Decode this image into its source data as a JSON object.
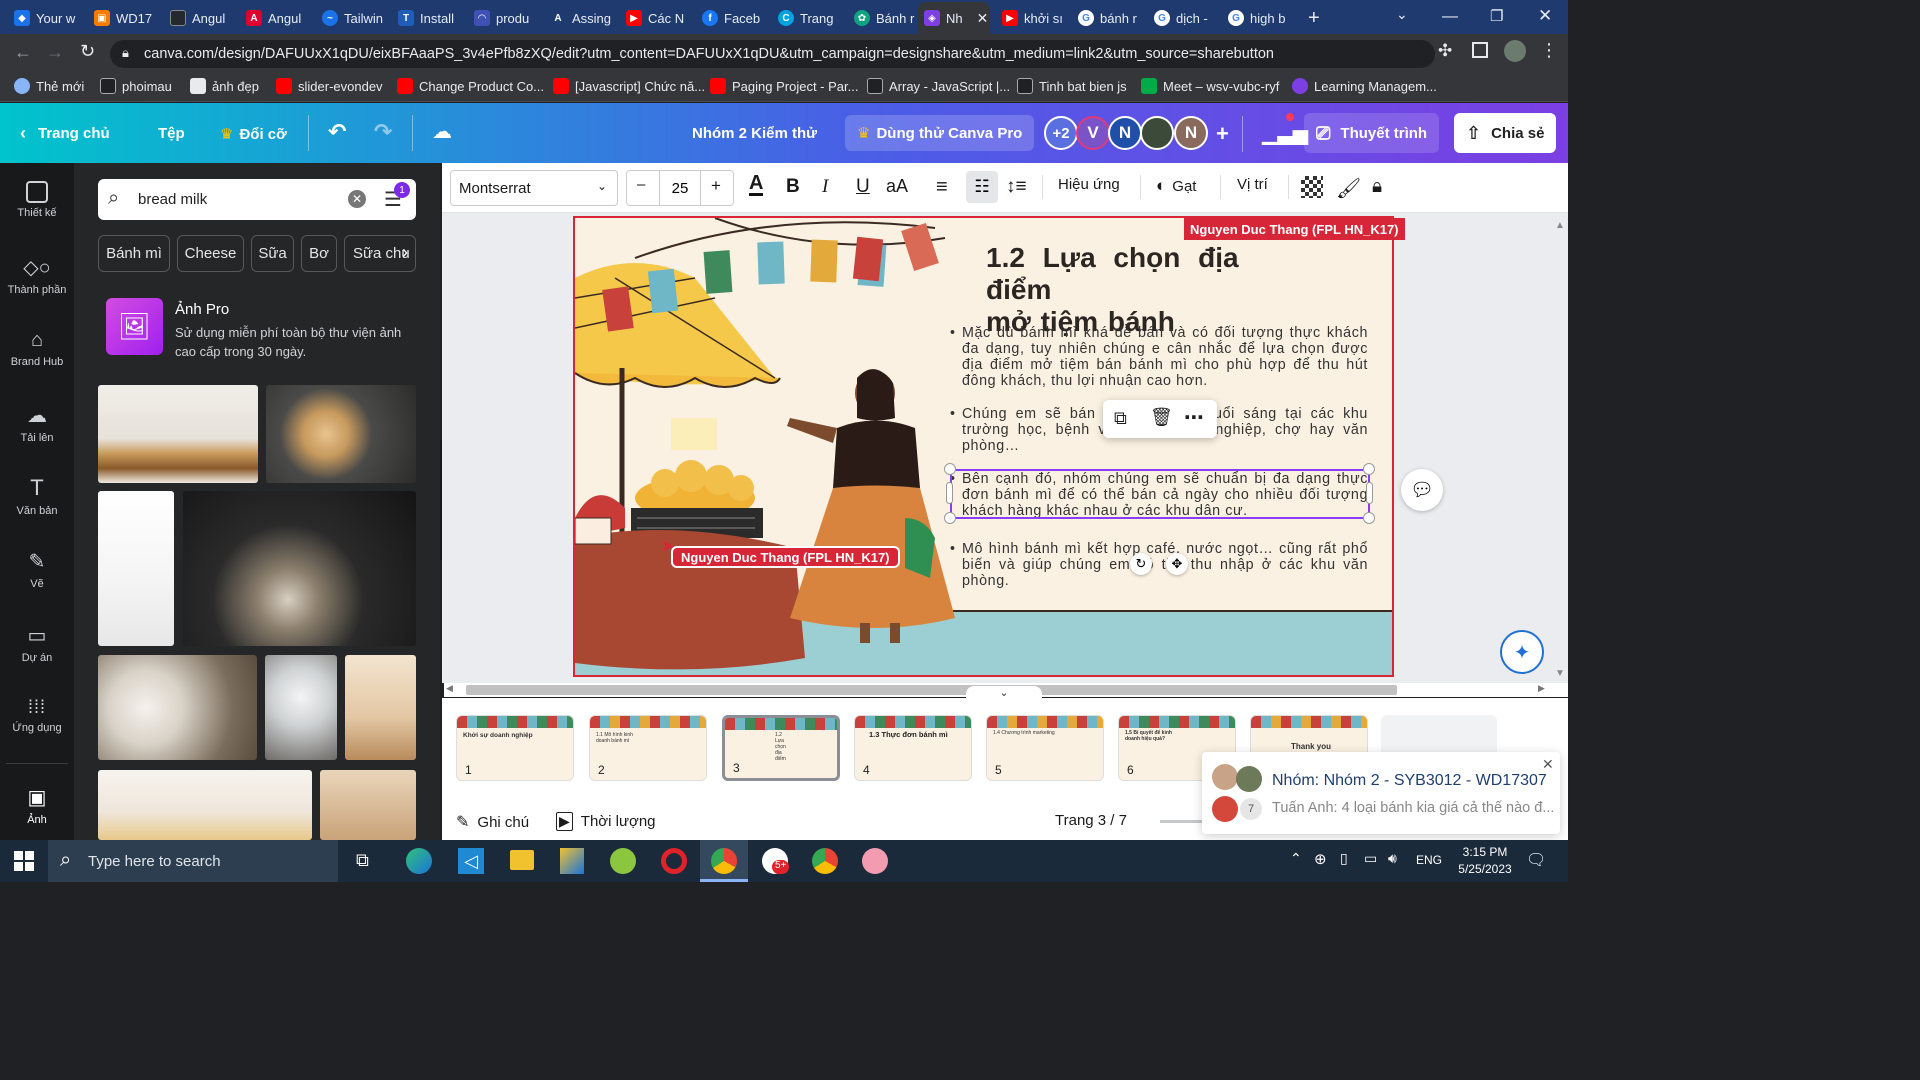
{
  "browser": {
    "tabs": [
      {
        "title": "Your w",
        "color": "#1a73e8"
      },
      {
        "title": "WD17",
        "color": "#f57c00"
      },
      {
        "title": "Angul",
        "color": "#24292f"
      },
      {
        "title": "Angul",
        "color": "#dd0031"
      },
      {
        "title": "Tailwin",
        "color": "#1a73e8"
      },
      {
        "title": "Install",
        "color": "#1e5eb8"
      },
      {
        "title": "produ",
        "color": "#3f51b5"
      },
      {
        "title": "Assing",
        "color": "#202124"
      },
      {
        "title": "Các N",
        "color": "#ff0000"
      },
      {
        "title": "Faceb",
        "color": "#1877f2"
      },
      {
        "title": "Trang",
        "color": "#00a3e0"
      },
      {
        "title": "Bánh r",
        "color": "#10a37f"
      },
      {
        "title": "Nh",
        "color": "#7b3fe4"
      },
      {
        "title": "khởi sı",
        "color": "#ff0000"
      },
      {
        "title": "bánh r",
        "color": "#ffffff"
      },
      {
        "title": "dịch -",
        "color": "#ffffff"
      },
      {
        "title": "high b",
        "color": "#ffffff"
      }
    ],
    "new_tab": "+",
    "url": "canva.com/design/DAFUUxX1qDU/eixBFAaaPS_3v4ePfb8zXQ/edit?utm_content=DAFUUxX1qDU&utm_campaign=designshare&utm_medium=link2&utm_source=sharebutton",
    "bookmarks": [
      {
        "label": "Thẻ mới",
        "color": "#8ab4f8"
      },
      {
        "label": "phoimau",
        "color": "#202124"
      },
      {
        "label": "ảnh đẹp",
        "color": "#e8eaed"
      },
      {
        "label": "slider-evondev",
        "color": "#ff0000"
      },
      {
        "label": "Change Product Co...",
        "color": "#ff0000"
      },
      {
        "label": "[Javascript] Chức nă...",
        "color": "#ff0000"
      },
      {
        "label": "Paging Project - Par...",
        "color": "#ff0000"
      },
      {
        "label": "Array - JavaScript |...",
        "color": "#202124"
      },
      {
        "label": "Tinh bat bien js",
        "color": "#202124"
      },
      {
        "label": "Meet – wsv-vubc-ryf",
        "color": "#00ac47"
      },
      {
        "label": "Learning Managem...",
        "color": "#7b3fe4"
      }
    ]
  },
  "header": {
    "home": "Trang chủ",
    "file": "Tệp",
    "resize": "Đổi cỡ",
    "title": "Nhóm 2 Kiểm thử",
    "try_pro": "Dùng thử Canva Pro",
    "extra_count": "+2",
    "avatars": [
      "V",
      "N",
      "N"
    ],
    "add": "+",
    "present": "Thuyết trình",
    "share": "Chia sẻ"
  },
  "rail": [
    "Thiết kế",
    "Thành phần",
    "Brand Hub",
    "Tải lên",
    "Văn bản",
    "Vẽ",
    "Dự án",
    "Ứng dụng",
    "Ảnh"
  ],
  "panel": {
    "search_value": "bread milk",
    "filter_count": "1",
    "chips": [
      "Bánh mì",
      "Cheese",
      "Sữa",
      "Bơ",
      "Sữa chu"
    ],
    "promo_title": "Ảnh Pro",
    "promo_desc": "Sử dụng miễn phí toàn bộ thư viện ảnh cao cấp trong 30 ngày."
  },
  "toolbar": {
    "font": "Montserrat",
    "minus": "–",
    "size": "25",
    "plus": "+",
    "effects": "Hiệu ứng",
    "erase": "Gạt",
    "position": "Vị trí"
  },
  "slide": {
    "collab_label": "Nguyen Duc Thang (FPL HN_K17)",
    "cursor_label": "Nguyen Duc Thang (FPL HN_K17)",
    "title_line1": "1.2 Lựa chọn địa điểm",
    "title_line2": "mở tiệm bánh",
    "bullets": [
      "Mặc dù bánh mì khá dễ bán và có đối tượng thực khách đa dạng, tuy nhiên chúng e cân nhắc để lựa chọn được địa điểm mở tiệm bán bánh mì cho phù hợp để thu hút đông khách, thu lợi nhuận cao hơn.",
      "Chúng em sẽ bán bánh mì vào buổi sáng tại các khu trường học, bệnh viện, khu công nghiệp, chợ hay văn phòng…",
      "Bên cạnh đó, nhóm chúng em sẽ chuẩn bị đa dạng thực đơn bánh mì để có thể bán cả ngày cho nhiều đối tượng khách hàng khác nhau ở các khu dân cư.",
      "Mô hình bánh mì kết hợp café, nước ngọt… cũng rất phổ biến và giúp chúng em có thể thu nhập ở các khu văn phòng."
    ],
    "bunting_colors": [
      "#c9413b",
      "#6fb6c7",
      "#3f8a5c",
      "#6fb6c7",
      "#e4a93b",
      "#6fb6c7",
      "#c9413b",
      "#d96a55"
    ]
  },
  "bottom": {
    "thumbs": [
      {
        "n": "1",
        "title": "Khởi sự doanh nghiệp"
      },
      {
        "n": "2",
        "title": "1.1 Mô hình kinh doanh bánh mì"
      },
      {
        "n": "3",
        "title": "1.2 Lựa chọn địa điểm"
      },
      {
        "n": "4",
        "title": "1.3 Thực đơn bánh mì"
      },
      {
        "n": "5",
        "title": "1.4 Chương trình marketing"
      },
      {
        "n": "6",
        "title": "1.5 Bí quyết để kinh doanh hiệu quả?"
      },
      {
        "n": "",
        "title": "Thank you"
      }
    ],
    "add_page": "+",
    "notes": "Ghi chú",
    "duration": "Thời lượng",
    "page_indicator": "Trang 3 / 7"
  },
  "notification": {
    "title": "Nhóm: Nhóm 2 - SYB3012 - WD17307",
    "message": "Tuấn Anh: 4 loại bánh kia giá cả thế nào đ...",
    "count": "7"
  },
  "taskbar": {
    "search_placeholder": "Type here to search",
    "language": "ENG",
    "time": "3:15 PM",
    "date": "5/25/2023",
    "chrome_badge": "5+"
  }
}
